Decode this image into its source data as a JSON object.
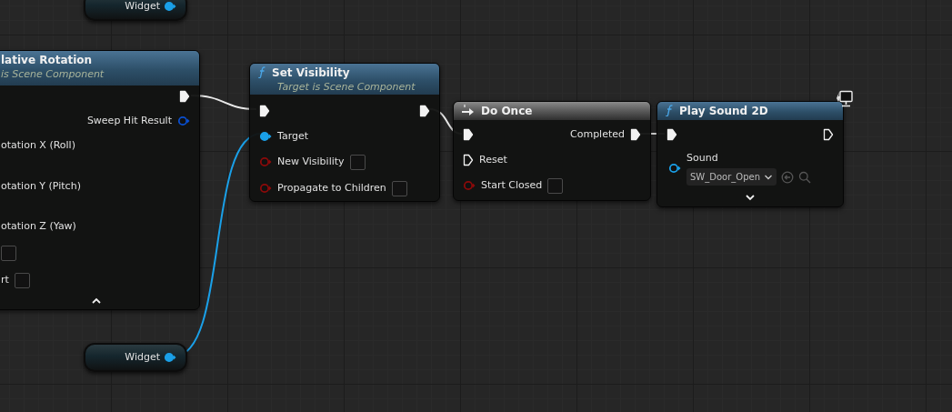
{
  "nodes": [
    {
      "kind": "variable",
      "title": "Widget",
      "pin": {
        "kind": "data",
        "connected": true,
        "color": "#1aa0e8"
      }
    },
    {
      "kind": "function",
      "title": "lative Rotation",
      "subtitle": "is Scene Component",
      "rows": [
        {
          "out": {
            "pin": {
              "kind": "exec",
              "connected": true
            }
          }
        },
        {
          "out": {
            "label": "Sweep Hit Result",
            "pin": {
              "kind": "data",
              "connected": false,
              "color": "#0a4fd0"
            }
          }
        },
        {
          "in": {
            "label": "otation X (Roll)"
          }
        },
        {
          "in": {
            "label": "otation Y (Pitch)"
          }
        },
        {
          "in": {
            "label": "otation Z (Yaw)"
          }
        },
        {
          "in": {
            "checkbox": {
              "checked": false
            }
          }
        },
        {
          "in": {
            "label": "rt",
            "checkbox": {
              "checked": false
            }
          }
        }
      ],
      "advanced_expanded": true
    },
    {
      "kind": "function",
      "title": "Set Visibility",
      "subtitle": "Target is Scene Component",
      "rows": [
        {
          "in": {
            "pin": {
              "kind": "exec",
              "connected": true
            }
          },
          "out": {
            "pin": {
              "kind": "exec",
              "connected": true
            }
          }
        },
        {
          "in": {
            "label": "Target",
            "pin": {
              "kind": "data",
              "connected": true,
              "color": "#1aa0e8"
            }
          }
        },
        {
          "in": {
            "label": "New Visibility",
            "pin": {
              "kind": "data",
              "connected": false,
              "color": "#8c0a0a"
            },
            "checkbox": {
              "checked": false
            }
          }
        },
        {
          "in": {
            "label": "Propagate to Children",
            "pin": {
              "kind": "data",
              "connected": false,
              "color": "#8c0a0a"
            },
            "checkbox": {
              "checked": false
            }
          }
        }
      ]
    },
    {
      "kind": "macro",
      "title": "Do Once",
      "rows": [
        {
          "in": {
            "pin": {
              "kind": "exec",
              "connected": true
            }
          },
          "out": {
            "label": "Completed",
            "pin": {
              "kind": "exec",
              "connected": true
            }
          }
        },
        {
          "in": {
            "label": "Reset",
            "pin": {
              "kind": "exec",
              "connected": false
            }
          }
        },
        {
          "in": {
            "label": "Start Closed",
            "pin": {
              "kind": "data",
              "connected": false,
              "color": "#8c0a0a"
            },
            "checkbox": {
              "checked": false
            }
          }
        }
      ]
    },
    {
      "kind": "function",
      "title": "Play Sound 2D",
      "client_only": true,
      "rows": [
        {
          "in": {
            "pin": {
              "kind": "exec",
              "connected": true
            }
          },
          "out": {
            "pin": {
              "kind": "exec",
              "connected": false
            }
          }
        },
        {
          "in": {
            "label": "Sound",
            "pin": {
              "kind": "data",
              "connected": false,
              "color": "#1aa0e8"
            },
            "field": {
              "value": "SW_Door_Open"
            }
          }
        }
      ],
      "advanced_expanded": false
    },
    {
      "kind": "variable",
      "title": "Widget",
      "pin": {
        "kind": "data",
        "connected": true,
        "color": "#1aa0e8"
      }
    }
  ],
  "wires": [
    {
      "kind": "exec"
    },
    {
      "kind": "exec"
    },
    {
      "kind": "exec"
    },
    {
      "kind": "data",
      "color": "#1aa0e8"
    }
  ]
}
